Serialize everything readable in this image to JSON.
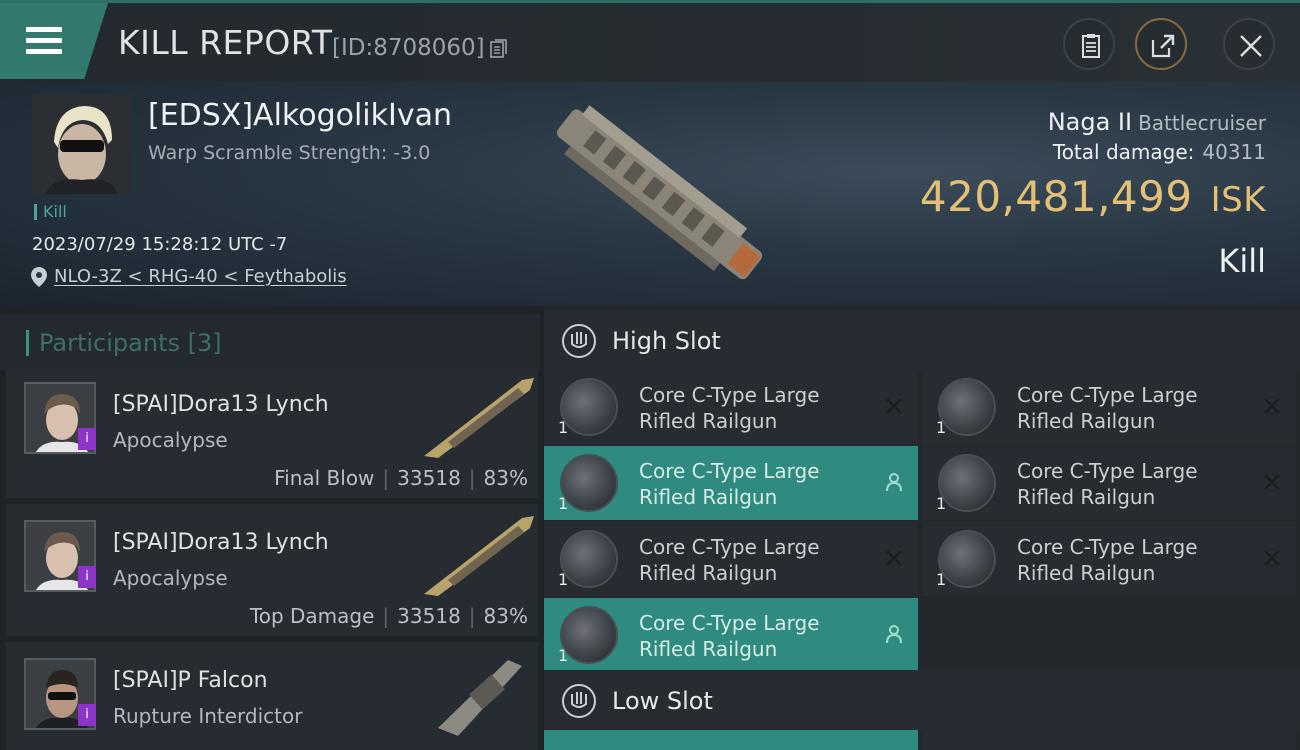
{
  "header": {
    "title": "KILL REPORT",
    "report_id": "[ID:8708060]"
  },
  "victim": {
    "name": "[EDSX]AlkogolikIvan",
    "warp_scramble": "Warp Scramble Strength: -3.0",
    "tag": "Kill",
    "datetime": "2023/07/29 15:28:12 UTC -7",
    "location": "NLO-3Z < RHG-40 < Feythabolis",
    "ship_name": "Naga II",
    "ship_class": "Battlecruiser",
    "damage_label": "Total damage:",
    "damage_value": "40311",
    "isk_value": "420,481,499",
    "isk_unit": "ISK",
    "result": "Kill"
  },
  "participants": {
    "title": "Participants",
    "count": "[3]",
    "items": [
      {
        "name": "[SPAI]Dora13 Lynch",
        "ship": "Apocalypse",
        "role": "Final Blow",
        "damage": "33518",
        "percent": "83%",
        "badge": "i"
      },
      {
        "name": "[SPAI]Dora13 Lynch",
        "ship": "Apocalypse",
        "role": "Top Damage",
        "damage": "33518",
        "percent": "83%",
        "badge": "i"
      },
      {
        "name": "[SPAI]P Falcon",
        "ship": "Rupture Interdictor",
        "role": "",
        "damage": "",
        "percent": "",
        "badge": "i"
      }
    ]
  },
  "slots": {
    "high": {
      "label": "High Slot",
      "modules": [
        {
          "line1": "Core C-Type Large",
          "line2": "Rifled Railgun",
          "qty": "1",
          "state": "destroyed"
        },
        {
          "line1": "Core C-Type Large",
          "line2": "Rifled Railgun",
          "qty": "1",
          "state": "destroyed"
        },
        {
          "line1": "Core C-Type Large",
          "line2": "Rifled Railgun",
          "qty": "1",
          "state": "dropped"
        },
        {
          "line1": "Core C-Type Large",
          "line2": "Rifled Railgun",
          "qty": "1",
          "state": "destroyed"
        },
        {
          "line1": "Core C-Type Large",
          "line2": "Rifled Railgun",
          "qty": "1",
          "state": "destroyed"
        },
        {
          "line1": "Core C-Type Large",
          "line2": "Rifled Railgun",
          "qty": "1",
          "state": "destroyed"
        },
        {
          "line1": "Core C-Type Large",
          "line2": "Rifled Railgun",
          "qty": "1",
          "state": "dropped"
        }
      ]
    },
    "low": {
      "label": "Low Slot"
    }
  },
  "colors": {
    "accent": "#34796e",
    "isk": "#e4c077",
    "active_row": "#2f8a7f",
    "badge": "#8d34c9"
  }
}
